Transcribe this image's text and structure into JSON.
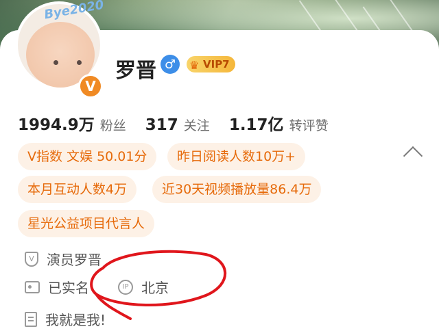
{
  "profile": {
    "name": "罗晋",
    "gender_symbol": "♂",
    "vip_label": "VIP7",
    "avatar_tag": "Bye2020",
    "verified_badge": "V"
  },
  "stats": [
    {
      "value": "1994.9万",
      "label": "粉丝"
    },
    {
      "value": "317",
      "label": "关注"
    },
    {
      "value": "1.17亿",
      "label": "转评赞"
    }
  ],
  "tags": [
    "V指数 文娱 50.01分",
    "昨日阅读人数10万+",
    "本月互动人数4万",
    "近30天视频播放量86.4万",
    "星光公益项目代言人"
  ],
  "info": {
    "verification": "演员罗晋",
    "real_name": "已实名",
    "ip_icon_text": "IP",
    "ip_location": "北京",
    "intro": "我就是我!"
  },
  "colors": {
    "accent_orange": "#e66a0a",
    "annotation_red": "#e0161c",
    "gender_blue": "#3d8ee8"
  }
}
